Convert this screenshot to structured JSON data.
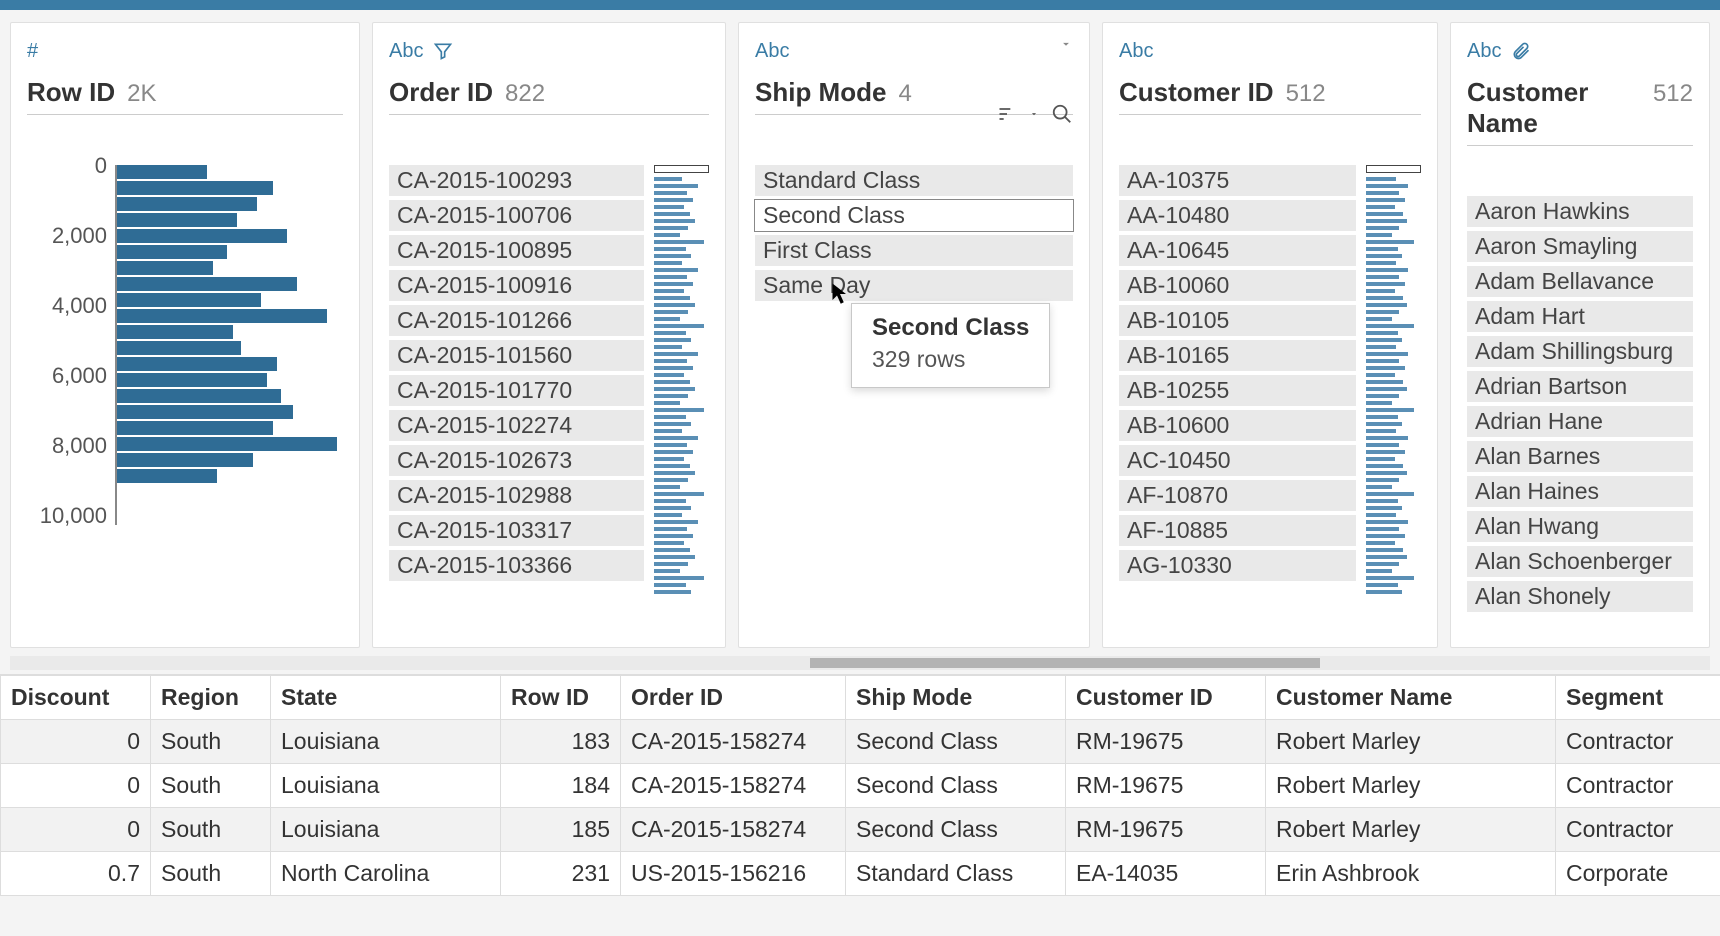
{
  "cards": {
    "rowid": {
      "type_label": "#",
      "title": "Row ID",
      "count": "2K",
      "axis": [
        "0",
        "2,000",
        "4,000",
        "6,000",
        "8,000",
        "10,000"
      ]
    },
    "orderid": {
      "type_label": "Abc",
      "title": "Order ID",
      "count": "822",
      "values": [
        "CA-2015-100293",
        "CA-2015-100706",
        "CA-2015-100895",
        "CA-2015-100916",
        "CA-2015-101266",
        "CA-2015-101560",
        "CA-2015-101770",
        "CA-2015-102274",
        "CA-2015-102673",
        "CA-2015-102988",
        "CA-2015-103317",
        "CA-2015-103366"
      ]
    },
    "shipmode": {
      "type_label": "Abc",
      "title": "Ship Mode",
      "count": "4",
      "values": [
        "Standard Class",
        "Second Class",
        "First Class",
        "Same Day"
      ]
    },
    "custid": {
      "type_label": "Abc",
      "title": "Customer ID",
      "count": "512",
      "values": [
        "AA-10375",
        "AA-10480",
        "AA-10645",
        "AB-10060",
        "AB-10105",
        "AB-10165",
        "AB-10255",
        "AB-10600",
        "AC-10450",
        "AF-10870",
        "AF-10885",
        "AG-10330"
      ]
    },
    "custname": {
      "type_label": "Abc",
      "title": "Customer Name",
      "count": "512",
      "values": [
        "Aaron Hawkins",
        "Aaron Smayling",
        "Adam Bellavance",
        "Adam Hart",
        "Adam Shillingsburg",
        "Adrian Bartson",
        "Adrian Hane",
        "Alan Barnes",
        "Alan Haines",
        "Alan Hwang",
        "Alan Schoenberger",
        "Alan Shonely"
      ]
    }
  },
  "tooltip": {
    "title": "Second Class",
    "sub": "329 rows"
  },
  "table": {
    "headers": [
      "Discount",
      "Region",
      "State",
      "Row ID",
      "Order ID",
      "Ship Mode",
      "Customer ID",
      "Customer Name",
      "Segment"
    ],
    "rows": [
      {
        "discount": "0",
        "region": "South",
        "state": "Louisiana",
        "rowid": "183",
        "orderid": "CA-2015-158274",
        "shipmode": "Second Class",
        "custid": "RM-19675",
        "custname": "Robert Marley",
        "segment": "Contractor"
      },
      {
        "discount": "0",
        "region": "South",
        "state": "Louisiana",
        "rowid": "184",
        "orderid": "CA-2015-158274",
        "shipmode": "Second Class",
        "custid": "RM-19675",
        "custname": "Robert Marley",
        "segment": "Contractor"
      },
      {
        "discount": "0",
        "region": "South",
        "state": "Louisiana",
        "rowid": "185",
        "orderid": "CA-2015-158274",
        "shipmode": "Second Class",
        "custid": "RM-19675",
        "custname": "Robert Marley",
        "segment": "Contractor"
      },
      {
        "discount": "0.7",
        "region": "South",
        "state": "North Carolina",
        "rowid": "231",
        "orderid": "US-2015-156216",
        "shipmode": "Standard Class",
        "custid": "EA-14035",
        "custname": "Erin Ashbrook",
        "segment": "Corporate"
      }
    ]
  },
  "chart_data": {
    "type": "bar",
    "orientation": "horizontal",
    "title": "Row ID distribution",
    "xlabel": "",
    "ylabel": "Row ID",
    "ylim": [
      0,
      10000
    ],
    "y_ticks": [
      0,
      2000,
      4000,
      6000,
      8000,
      10000
    ],
    "bins": [
      {
        "start": 0,
        "end": 500,
        "count": 45
      },
      {
        "start": 500,
        "end": 1000,
        "count": 78
      },
      {
        "start": 1000,
        "end": 1500,
        "count": 70
      },
      {
        "start": 1500,
        "end": 2000,
        "count": 60
      },
      {
        "start": 2000,
        "end": 2500,
        "count": 85
      },
      {
        "start": 2500,
        "end": 3000,
        "count": 55
      },
      {
        "start": 3000,
        "end": 3500,
        "count": 48
      },
      {
        "start": 3500,
        "end": 4000,
        "count": 90
      },
      {
        "start": 4000,
        "end": 4500,
        "count": 72
      },
      {
        "start": 4500,
        "end": 5000,
        "count": 105
      },
      {
        "start": 5000,
        "end": 5500,
        "count": 58
      },
      {
        "start": 5500,
        "end": 6000,
        "count": 62
      },
      {
        "start": 6000,
        "end": 6500,
        "count": 80
      },
      {
        "start": 6500,
        "end": 7000,
        "count": 75
      },
      {
        "start": 7000,
        "end": 7500,
        "count": 82
      },
      {
        "start": 7500,
        "end": 8000,
        "count": 88
      },
      {
        "start": 8000,
        "end": 8500,
        "count": 78
      },
      {
        "start": 8500,
        "end": 9000,
        "count": 110
      },
      {
        "start": 9000,
        "end": 9500,
        "count": 68
      },
      {
        "start": 9500,
        "end": 10000,
        "count": 50
      }
    ]
  }
}
